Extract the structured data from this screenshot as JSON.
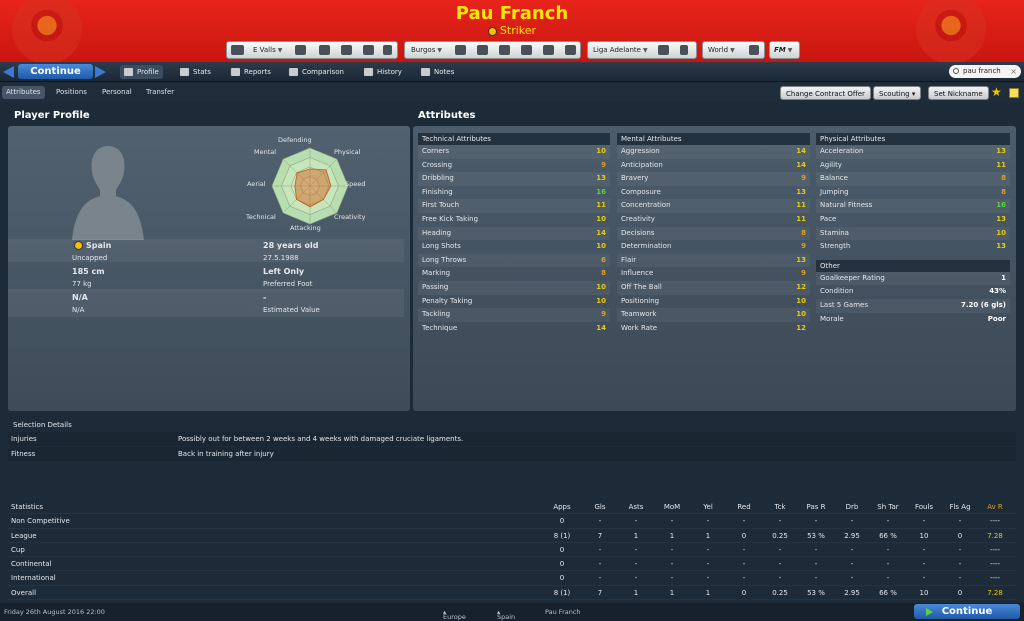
{
  "header": {
    "player_name": "Pau Franch",
    "position": "Striker",
    "toolbar": {
      "club": "E Valls",
      "team": "Burgos",
      "competition": "Liga Adelante",
      "world": "World",
      "fm": "FM"
    }
  },
  "nav": {
    "continue_label": "Continue",
    "items": [
      {
        "label": "Profile"
      },
      {
        "label": "Stats"
      },
      {
        "label": "Reports"
      },
      {
        "label": "Comparison"
      },
      {
        "label": "History"
      },
      {
        "label": "Notes"
      }
    ],
    "search_value": "pau franch"
  },
  "subnav": {
    "tabs": [
      "Attributes",
      "Positions",
      "Personal",
      "Transfer"
    ],
    "buttons": {
      "change_contract": "Change Contract Offer",
      "scouting": "Scouting",
      "set_nickname": "Set Nickname"
    }
  },
  "profile": {
    "title": "Player Profile",
    "radar_labels": {
      "defending": "Defending",
      "physical": "Physical",
      "speed": "Speed",
      "creativity": "Creativity",
      "attacking": "Attacking",
      "technical": "Technical",
      "aerial": "Aerial",
      "mental": "Mental"
    },
    "radar_values": [
      0.45,
      0.6,
      0.55,
      0.5,
      0.55,
      0.5,
      0.4,
      0.48
    ],
    "nation": "Spain",
    "caps": "Uncapped",
    "age": "28 years old",
    "dob": "27.5.1988",
    "height": "185 cm",
    "weight": "77 kg",
    "foot": "Left Only",
    "foot_label": "Preferred Foot",
    "value_main": "N/A",
    "value_sub": "N/A",
    "estimated": "-",
    "estimated_label": "Estimated Value"
  },
  "attributes": {
    "title": "Attributes",
    "technical_header": "Technical Attributes",
    "mental_header": "Mental Attributes",
    "physical_header": "Physical Attributes",
    "other_header": "Other",
    "technical": [
      {
        "name": "Corners",
        "value": "10",
        "c": "y"
      },
      {
        "name": "Crossing",
        "value": "9",
        "c": "o"
      },
      {
        "name": "Dribbling",
        "value": "13",
        "c": "y"
      },
      {
        "name": "Finishing",
        "value": "16",
        "c": "g"
      },
      {
        "name": "First Touch",
        "value": "11",
        "c": "y"
      },
      {
        "name": "Free Kick Taking",
        "value": "10",
        "c": "y"
      },
      {
        "name": "Heading",
        "value": "14",
        "c": "y"
      },
      {
        "name": "Long Shots",
        "value": "10",
        "c": "y"
      },
      {
        "name": "Long Throws",
        "value": "6",
        "c": "o"
      },
      {
        "name": "Marking",
        "value": "8",
        "c": "o"
      },
      {
        "name": "Passing",
        "value": "10",
        "c": "y"
      },
      {
        "name": "Penalty Taking",
        "value": "10",
        "c": "y"
      },
      {
        "name": "Tackling",
        "value": "9",
        "c": "o"
      },
      {
        "name": "Technique",
        "value": "14",
        "c": "y"
      }
    ],
    "mental": [
      {
        "name": "Aggression",
        "value": "14",
        "c": "y"
      },
      {
        "name": "Anticipation",
        "value": "14",
        "c": "y"
      },
      {
        "name": "Bravery",
        "value": "9",
        "c": "o"
      },
      {
        "name": "Composure",
        "value": "13",
        "c": "y"
      },
      {
        "name": "Concentration",
        "value": "11",
        "c": "y"
      },
      {
        "name": "Creativity",
        "value": "11",
        "c": "y"
      },
      {
        "name": "Decisions",
        "value": "8",
        "c": "o"
      },
      {
        "name": "Determination",
        "value": "9",
        "c": "o"
      },
      {
        "name": "Flair",
        "value": "13",
        "c": "y"
      },
      {
        "name": "Influence",
        "value": "9",
        "c": "o"
      },
      {
        "name": "Off The Ball",
        "value": "12",
        "c": "y"
      },
      {
        "name": "Positioning",
        "value": "10",
        "c": "y"
      },
      {
        "name": "Teamwork",
        "value": "10",
        "c": "y"
      },
      {
        "name": "Work Rate",
        "value": "12",
        "c": "y"
      }
    ],
    "physical": [
      {
        "name": "Acceleration",
        "value": "13",
        "c": "y"
      },
      {
        "name": "Agility",
        "value": "11",
        "c": "y"
      },
      {
        "name": "Balance",
        "value": "8",
        "c": "o"
      },
      {
        "name": "Jumping",
        "value": "8",
        "c": "o"
      },
      {
        "name": "Natural Fitness",
        "value": "16",
        "c": "g"
      },
      {
        "name": "Pace",
        "value": "13",
        "c": "y"
      },
      {
        "name": "Stamina",
        "value": "10",
        "c": "y"
      },
      {
        "name": "Strength",
        "value": "13",
        "c": "y"
      }
    ],
    "other": [
      {
        "name": "Goalkeeper Rating",
        "value": "1",
        "c": "w"
      },
      {
        "name": "Condition",
        "value": "43%",
        "c": "w"
      },
      {
        "name": "Last 5 Games",
        "value": "7.20 (6 gls)",
        "c": "w"
      },
      {
        "name": "Morale",
        "value": "Poor",
        "c": "w"
      }
    ]
  },
  "selection": {
    "title": "Selection Details",
    "rows": [
      {
        "label": "Injuries",
        "text": "Possibly out for between 2 weeks and 4 weeks with damaged cruciate ligaments."
      },
      {
        "label": "Fitness",
        "text": "Back in training after injury"
      }
    ]
  },
  "stats": {
    "title": "Statistics",
    "columns": [
      "Apps",
      "Gls",
      "Asts",
      "MoM",
      "Yel",
      "Red",
      "Tck",
      "Pas R",
      "Drb",
      "Sh Tar",
      "Fouls",
      "Fls Ag",
      "Av R"
    ],
    "rows": [
      {
        "label": "Non Competitive",
        "cells": [
          "0",
          "-",
          "-",
          "-",
          "-",
          "-",
          "-",
          "-",
          "-",
          "-",
          "-",
          "-",
          "----"
        ]
      },
      {
        "label": "League",
        "cells": [
          "8 (1)",
          "7",
          "1",
          "1",
          "1",
          "0",
          "0.25",
          "53 %",
          "2.95",
          "66 %",
          "10",
          "0",
          "7.28"
        ]
      },
      {
        "label": "Cup",
        "cells": [
          "0",
          "-",
          "-",
          "-",
          "-",
          "-",
          "-",
          "-",
          "-",
          "-",
          "-",
          "-",
          "----"
        ]
      },
      {
        "label": "Continental",
        "cells": [
          "0",
          "-",
          "-",
          "-",
          "-",
          "-",
          "-",
          "-",
          "-",
          "-",
          "-",
          "-",
          "----"
        ]
      },
      {
        "label": "International",
        "cells": [
          "0",
          "-",
          "-",
          "-",
          "-",
          "-",
          "-",
          "-",
          "-",
          "-",
          "-",
          "-",
          "----"
        ]
      },
      {
        "label": "Overall",
        "cells": [
          "8 (1)",
          "7",
          "1",
          "1",
          "1",
          "0",
          "0.25",
          "53 %",
          "2.95",
          "66 %",
          "10",
          "0",
          "7.28"
        ]
      }
    ]
  },
  "footer": {
    "date": "Friday 26th August 2016 22:00",
    "crumb1": "Europe",
    "crumb2": "Spain",
    "crumb3": "Pau Franch",
    "continue_label": "Continue"
  },
  "colors": {
    "header_red": "#d81c14",
    "name_yellow": "#ffe600",
    "accent_blue": "#2a6cc2",
    "good": "#58d442",
    "mid": "#e6cc1a"
  }
}
